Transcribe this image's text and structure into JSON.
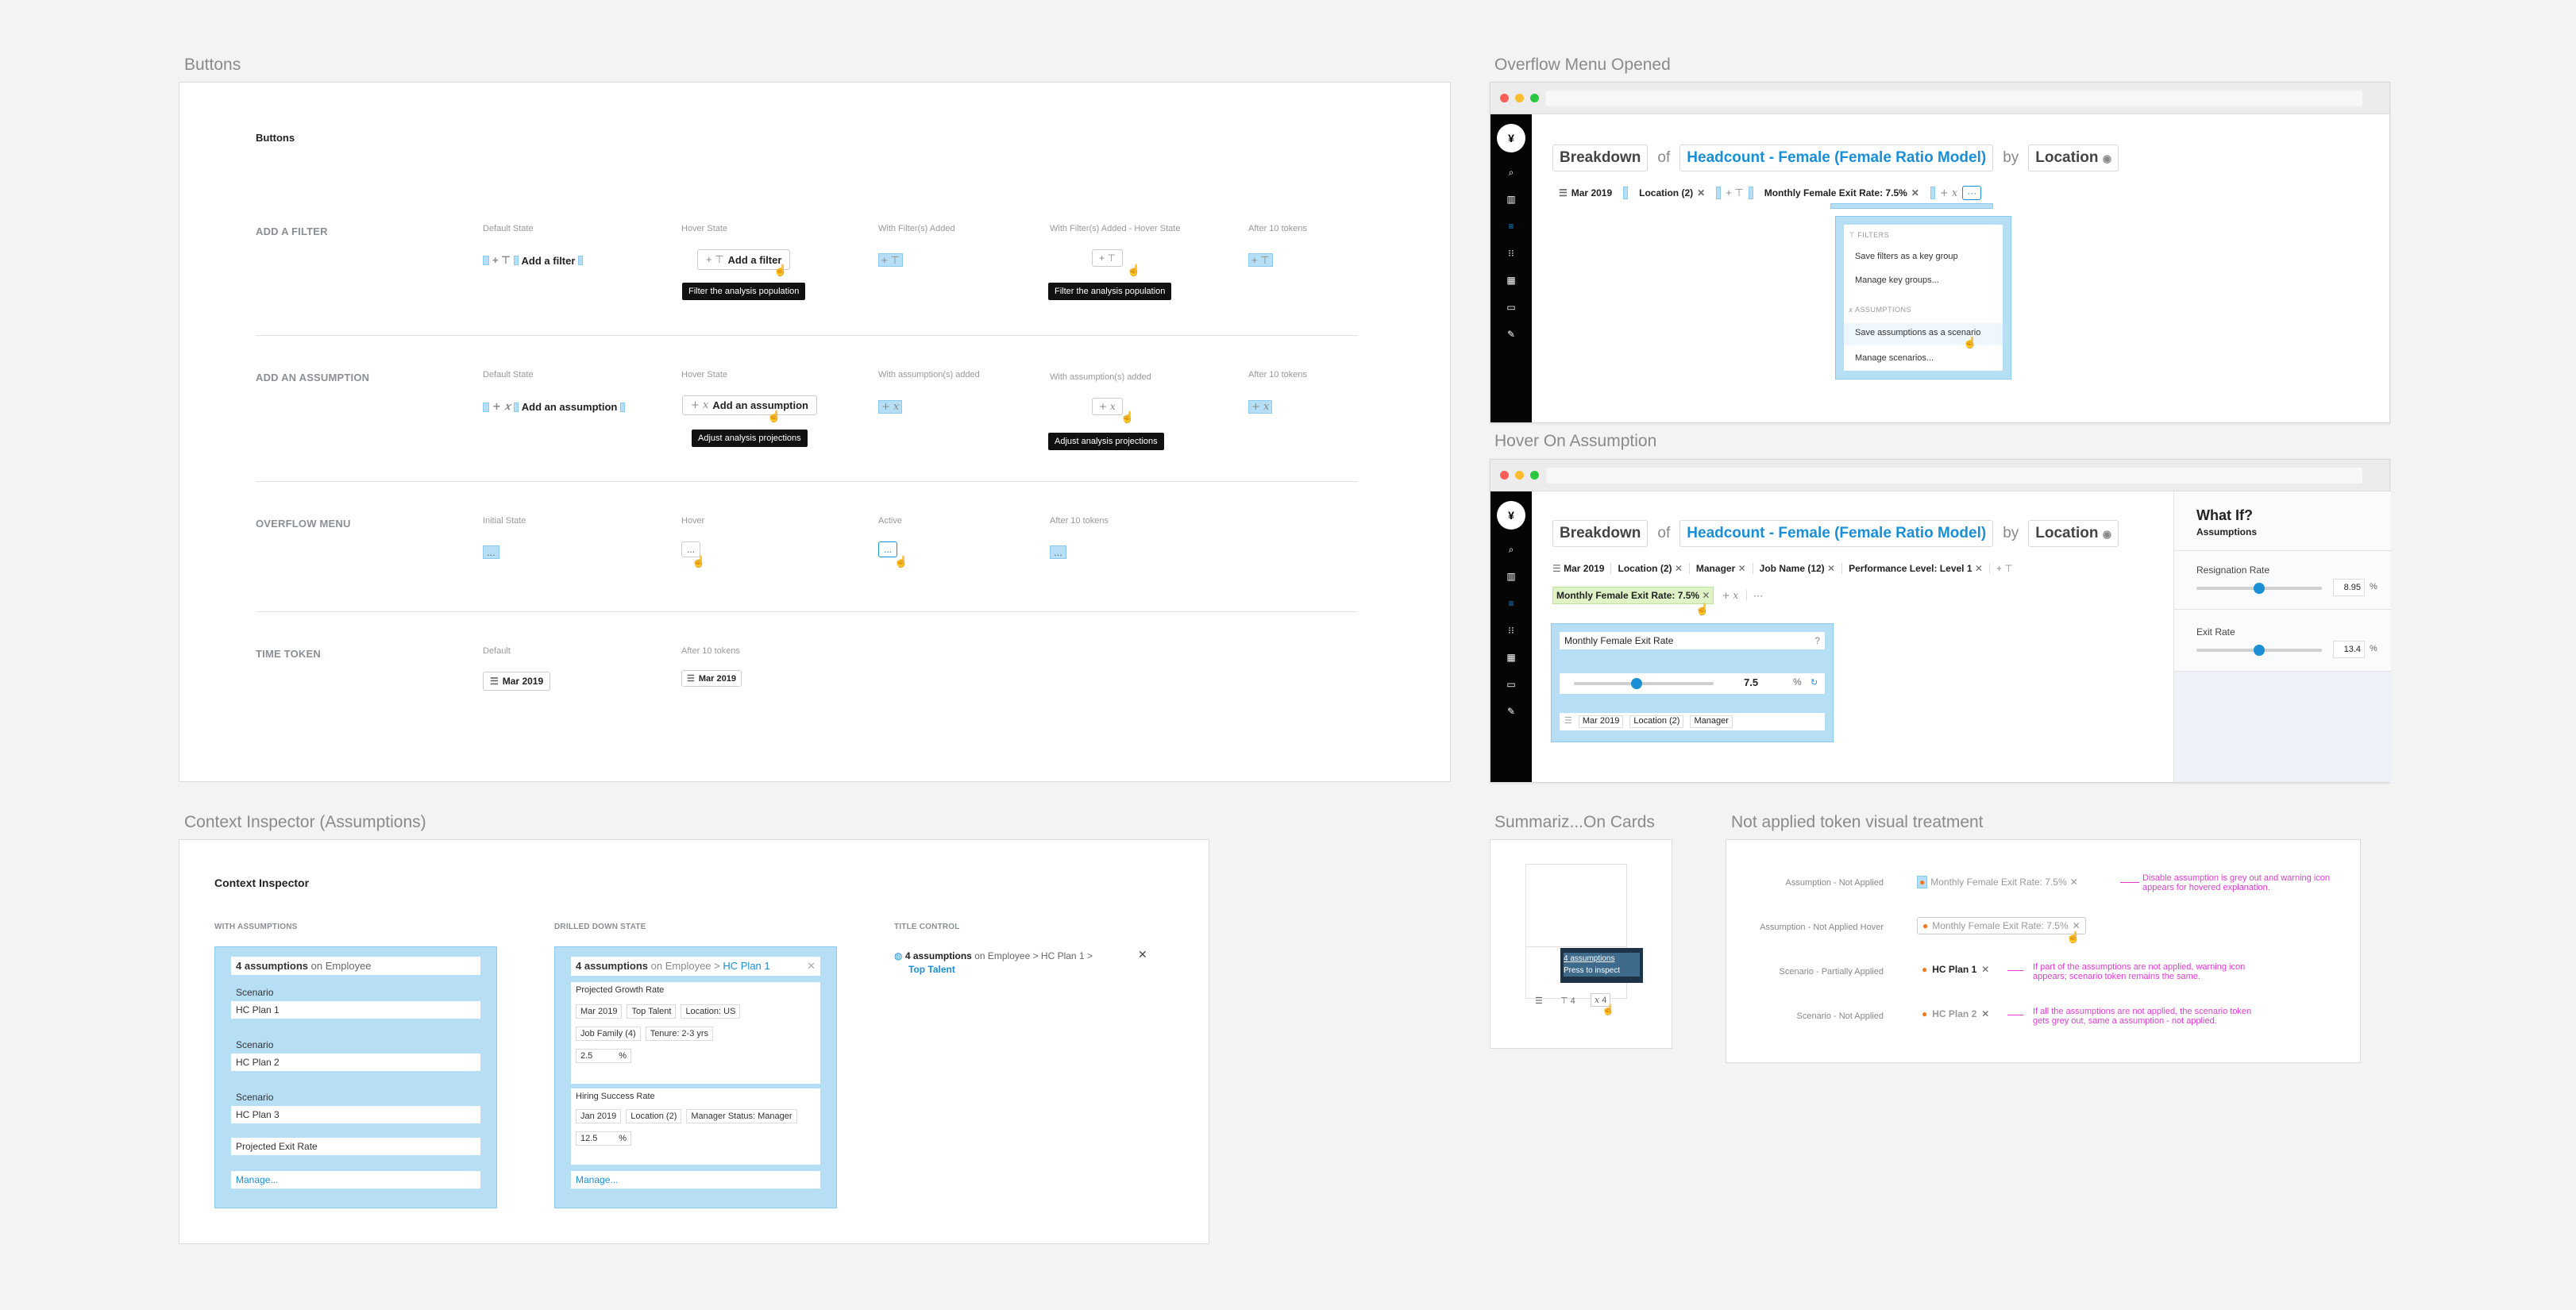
{
  "buttons_frame": {
    "title": "Buttons",
    "board_title": "Buttons",
    "sections": [
      {
        "label": "ADD A FILTER",
        "states": [
          "Default State",
          "Hover State",
          "With Filter(s) Added",
          "With Filter(s) Added - Hover State",
          "After 10 tokens"
        ],
        "button": "Add a filter",
        "tooltip": "Filter the analysis population"
      },
      {
        "label": "ADD AN ASSUMPTION",
        "states": [
          "Default State",
          "Hover State",
          "With assumption(s) added",
          "With assumption(s) added",
          "After 10 tokens"
        ],
        "button": "Add an assumption",
        "tooltip": "Adjust analysis projections"
      },
      {
        "label": "OVERFLOW MENU",
        "states": [
          "Initial State",
          "Hover",
          "Active",
          "After 10 tokens"
        ],
        "button": "...",
        "tooltip": ""
      },
      {
        "label": "TIME TOKEN",
        "states": [
          "Default",
          "After 10 tokens"
        ],
        "button": "Mar 2019",
        "tooltip": ""
      }
    ]
  },
  "overflow_frame": {
    "title": "Overflow Menu Opened",
    "breakdown": "Breakdown",
    "of": "of",
    "metric": "Headcount - Female (Female Ratio Model)",
    "by": "by",
    "dimension": "Location",
    "tokens": [
      "Mar 2019",
      "Location (2)",
      "Monthly Female Exit Rate: 7.5%"
    ],
    "menu": {
      "filters_header": "FILTERS",
      "save_filters": "Save filters as a key group",
      "manage_groups": "Manage key groups...",
      "assumptions_header": "ASSUMPTIONS",
      "save_assumptions": "Save assumptions as a scenario",
      "manage_scenarios": "Manage scenarios..."
    }
  },
  "hover_frame": {
    "title": "Hover On Assumption",
    "breakdown": "Breakdown",
    "of": "of",
    "metric": "Headcount - Female (Female Ratio Model)",
    "by": "by",
    "dimension": "Location",
    "tokens": [
      "Mar 2019",
      "Location (2)",
      "Manager",
      "Job Name (12)",
      "Performance Level: Level 1"
    ],
    "assumption_token": "Monthly Female Exit Rate: 7.5%",
    "popover_title": "Monthly Female Exit Rate",
    "popover_value": "7.5",
    "popover_unit": "%",
    "popover_tokens": [
      "Mar 2019",
      "Location (2)",
      "Manager"
    ],
    "popover_slider_fraction": 0.45,
    "panel": {
      "title": "What If?",
      "subtitle": "Assumptions",
      "rows": [
        {
          "label": "Resignation Rate",
          "value": "8.95",
          "unit": "%",
          "slider_fraction": 0.5
        },
        {
          "label": "Exit Rate",
          "value": "13.4",
          "unit": "%",
          "slider_fraction": 0.5
        }
      ]
    }
  },
  "context_frame": {
    "title": "Context Inspector (Assumptions)",
    "board_title": "Context Inspector",
    "col1_label": "WITH ASSUMPTIONS",
    "col2_label": "DRILLED DOWN STATE",
    "col3_label": "TITLE CONTROL",
    "col1_header_bold": "4 assumptions",
    "col1_header_rest": "on Employee",
    "col1_rows": [
      "Scenario",
      "HC Plan 1",
      "Scenario",
      "HC Plan 2",
      "Scenario",
      "HC Plan 3",
      "Projected Exit Rate"
    ],
    "manage": "Manage...",
    "col2_header_bold": "4 assumptions",
    "col2_header_mid": "on Employee >",
    "col2_header_link": "HC Plan 1",
    "col2_block1_title": "Projected Growth Rate",
    "col2_block1_tokens": [
      "Mar 2019",
      "Top Talent",
      "Location: US",
      "Job Family (4)",
      "Tenure: 2-3 yrs"
    ],
    "col2_block1_value": "2.5",
    "col2_block2_title": "Hiring Success Rate",
    "col2_block2_tokens": [
      "Jan 2019",
      "Location (2)",
      "Manager Status: Manager"
    ],
    "col2_block2_value": "12.5",
    "unit": "%",
    "title_control_bold": "4 assumptions",
    "title_control_rest": "on Employee > HC Plan 1 >",
    "title_control_link": "Top Talent"
  },
  "summ_frame": {
    "title": "Summariz...On Cards",
    "tip_line1": "4 assumptions",
    "tip_line2": "Press to inspect",
    "filter_count": "4",
    "assumption_count": "4"
  },
  "notapplied_frame": {
    "title": "Not applied token visual treatment",
    "rows": [
      {
        "label": "Assumption - Not Applied",
        "token": "Monthly Female Exit Rate: 7.5%",
        "note": "Disable assumption is grey out and warning icon appears for hovered explanation."
      },
      {
        "label": "Assumption - Not Applied Hover",
        "token": "Monthly Female Exit Rate: 7.5%",
        "note": ""
      },
      {
        "label": "Scenario - Partially Applied",
        "token": "HC Plan 1",
        "note": "If part of the assumptions are not applied, warning icon appears; scenario token remains the same."
      },
      {
        "label": "Scenario - Not Applied",
        "token": "HC Plan 2",
        "note": "If all the assumptions are not applied, the scenario token gets grey out, same a assumption - not applied."
      }
    ]
  },
  "colors": {
    "accent": "#1a8fd6",
    "highlight": "#b6dff6",
    "annotation": "#e13bd1",
    "warning": "#f07a22"
  }
}
